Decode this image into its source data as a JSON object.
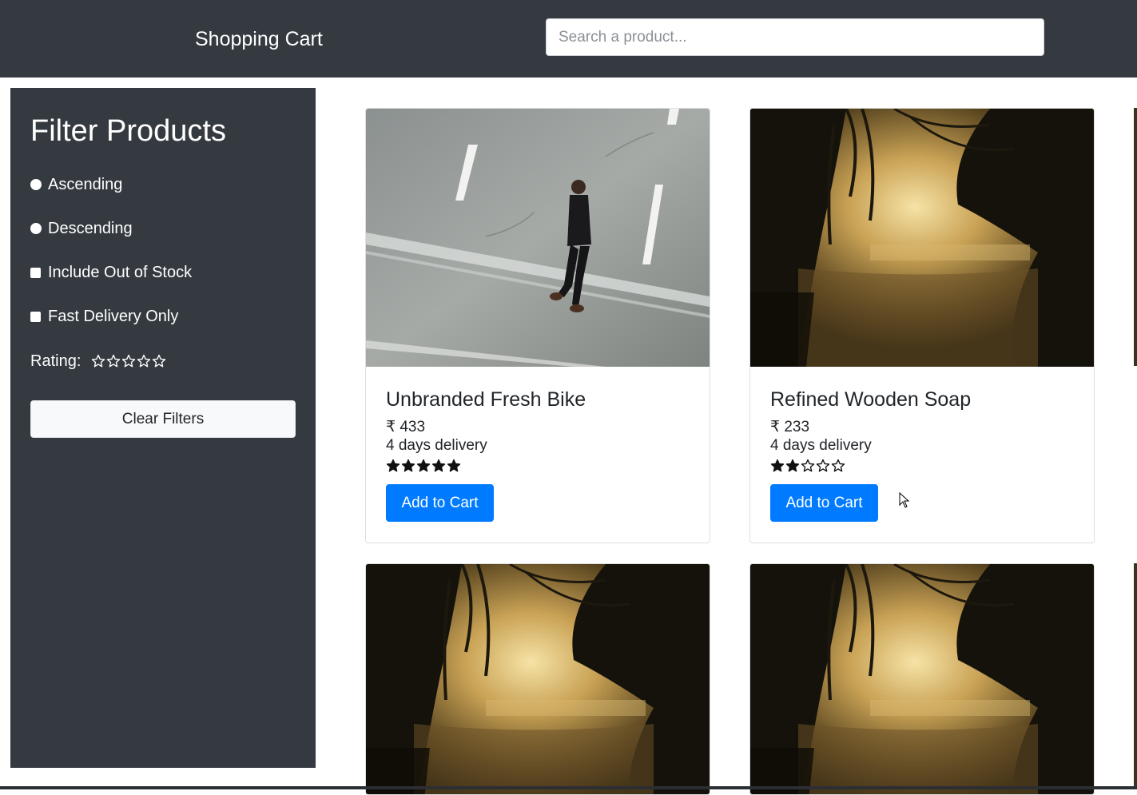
{
  "header": {
    "brand": "Shopping Cart",
    "search_placeholder": "Search a product..."
  },
  "sidebar": {
    "title": "Filter Products",
    "options": [
      {
        "label": "Ascending",
        "type": "radio"
      },
      {
        "label": "Descending",
        "type": "radio"
      },
      {
        "label": "Include Out of Stock",
        "type": "checkbox"
      },
      {
        "label": "Fast Delivery Only",
        "type": "checkbox"
      }
    ],
    "rating_label": "Rating:",
    "rating_value": 0,
    "rating_max": 5,
    "clear_label": "Clear Filters"
  },
  "products": [
    {
      "name": "Unbranded Fresh Bike",
      "price": "₹ 433",
      "delivery": "4 days delivery",
      "rating": 5,
      "button": "Add to Cart",
      "image": "person-walking-on-road"
    },
    {
      "name": "Refined Wooden Soap",
      "price": "₹ 233",
      "delivery": "4 days delivery",
      "rating": 2,
      "button": "Add to Cart",
      "image": "sunset-lake-trees"
    },
    {
      "image": "sunset-lake-trees"
    },
    {
      "image": "sunset-lake-trees"
    }
  ],
  "colors": {
    "navbar": "#343a40",
    "primary": "#007bff",
    "light": "#f8f9fa"
  }
}
